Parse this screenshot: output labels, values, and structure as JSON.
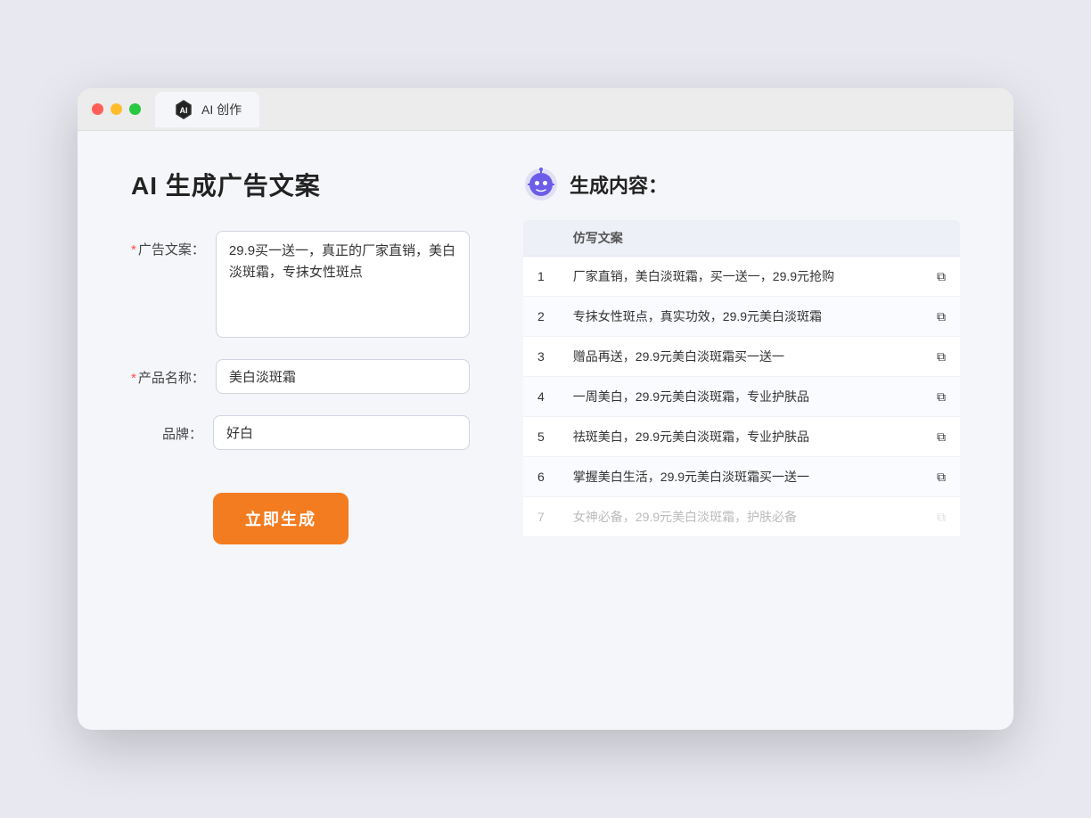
{
  "browser": {
    "tab_label": "AI 创作"
  },
  "page": {
    "title": "AI 生成广告文案",
    "right_title": "生成内容："
  },
  "form": {
    "ad_copy_label": "广告文案：",
    "ad_copy_required": "*",
    "ad_copy_value": "29.9买一送一，真正的厂家直销，美白淡斑霜，专抹女性斑点",
    "product_name_label": "产品名称：",
    "product_name_required": "*",
    "product_name_value": "美白淡斑霜",
    "brand_label": "品牌：",
    "brand_value": "好白",
    "generate_btn": "立即生成"
  },
  "results": {
    "column_label": "仿写文案",
    "items": [
      {
        "num": "1",
        "text": "厂家直销，美白淡斑霜，买一送一，29.9元抢购",
        "faded": false
      },
      {
        "num": "2",
        "text": "专抹女性斑点，真实功效，29.9元美白淡斑霜",
        "faded": false
      },
      {
        "num": "3",
        "text": "赠品再送，29.9元美白淡斑霜买一送一",
        "faded": false
      },
      {
        "num": "4",
        "text": "一周美白，29.9元美白淡斑霜，专业护肤品",
        "faded": false
      },
      {
        "num": "5",
        "text": "祛斑美白，29.9元美白淡斑霜，专业护肤品",
        "faded": false
      },
      {
        "num": "6",
        "text": "掌握美白生活，29.9元美白淡斑霜买一送一",
        "faded": false
      },
      {
        "num": "7",
        "text": "女神必备，29.9元美白淡斑霜，护肤必备",
        "faded": true
      }
    ]
  }
}
